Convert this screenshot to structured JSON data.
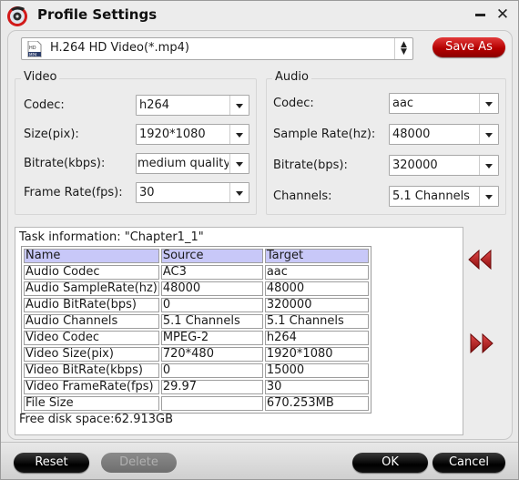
{
  "window": {
    "title": "Profile Settings",
    "minimize_icon": "minimize-icon",
    "close_icon": "close-icon",
    "app_icon": "app-disc-icon"
  },
  "profile": {
    "selected": "H.264 HD Video(*.mp4)",
    "icon": "hd-mp4-icon",
    "save_as_label": "Save As"
  },
  "video": {
    "legend": "Video",
    "fields": [
      {
        "label": "Codec:",
        "value": "h264"
      },
      {
        "label": "Size(pix):",
        "value": "1920*1080"
      },
      {
        "label": "Bitrate(kbps):",
        "value": "medium quality"
      },
      {
        "label": "Frame Rate(fps):",
        "value": "30"
      }
    ]
  },
  "audio": {
    "legend": "Audio",
    "fields": [
      {
        "label": "Codec:",
        "value": "aac"
      },
      {
        "label": "Sample Rate(hz):",
        "value": "48000"
      },
      {
        "label": "Bitrate(bps):",
        "value": "320000"
      },
      {
        "label": "Channels:",
        "value": "5.1 Channels"
      }
    ]
  },
  "task": {
    "title": "Task information: \"Chapter1_1\"",
    "columns": [
      "Name",
      "Source",
      "Target"
    ],
    "rows": [
      [
        "Audio Codec",
        "AC3",
        "aac"
      ],
      [
        "Audio SampleRate(hz)",
        "48000",
        "48000"
      ],
      [
        "Audio BitRate(bps)",
        "0",
        "320000"
      ],
      [
        "Audio Channels",
        "5.1 Channels",
        "5.1 Channels"
      ],
      [
        "Video Codec",
        "MPEG-2",
        "h264"
      ],
      [
        "Video Size(pix)",
        "720*480",
        "1920*1080"
      ],
      [
        "Video BitRate(kbps)",
        "0",
        "15000"
      ],
      [
        "Video FrameRate(fps)",
        "29.97",
        "30"
      ],
      [
        "File Size",
        "",
        "670.253MB"
      ]
    ],
    "free_disk": "Free disk space:62.913GB"
  },
  "nav": {
    "prev_icon": "rewind-icon",
    "next_icon": "fast-forward-icon"
  },
  "footer": {
    "reset_label": "Reset",
    "delete_label": "Delete",
    "ok_label": "OK",
    "cancel_label": "Cancel"
  },
  "colors": {
    "accent_red": "#c00000",
    "table_header": "#c8c8f8"
  }
}
